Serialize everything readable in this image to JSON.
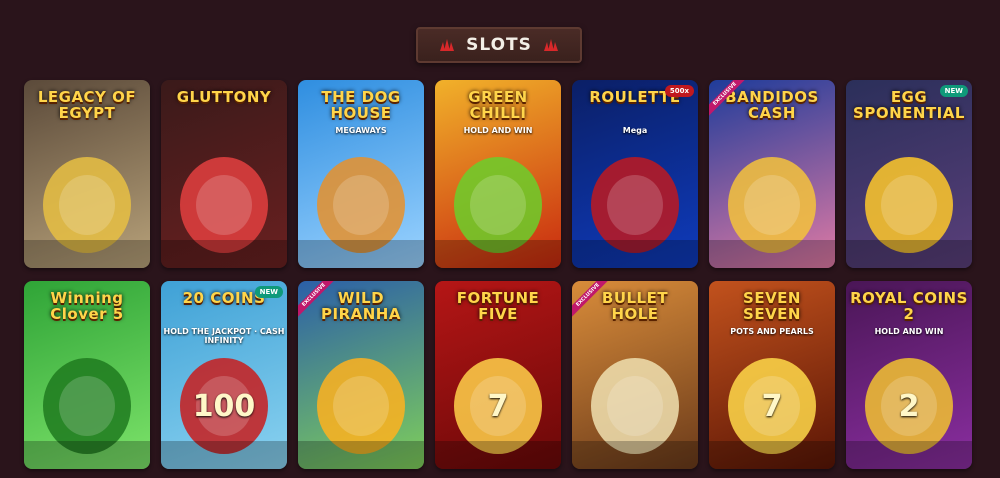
{
  "section": {
    "title": "SLOTS"
  },
  "games": [
    {
      "name": "LEGACY OF EGYPT",
      "sub": "",
      "bg": [
        "#5b4a3a",
        "#b8a27a"
      ],
      "accent": "#e8c043"
    },
    {
      "name": "GLUTTONY",
      "sub": "",
      "bg": [
        "#3a1a1a",
        "#6a2020"
      ],
      "accent": "#e34040"
    },
    {
      "name": "THE DOG HOUSE",
      "sub": "MEGAWAYS",
      "bg": [
        "#2f8ee0",
        "#9bd3ff"
      ],
      "accent": "#e8902a"
    },
    {
      "name": "GREEN CHILLI",
      "sub": "HOLD AND WIN",
      "bg": [
        "#f1b12a",
        "#c8290f"
      ],
      "accent": "#6bcf2b"
    },
    {
      "name": "ROULETTE",
      "sub": "Mega",
      "badge_value": "500x",
      "bg": [
        "#0b1f66",
        "#0e3bbd"
      ],
      "accent": "#c0191f"
    },
    {
      "name": "BANDIDOS CASH",
      "sub": "",
      "ribbon": "EXCLUSIVE",
      "bg": [
        "#1f3c9a",
        "#e07aa4"
      ],
      "accent": "#f5c33b"
    },
    {
      "name": "EGG SPONENTIAL",
      "sub": "",
      "new": "NEW",
      "bg": [
        "#2b2f5a",
        "#5a3f7a"
      ],
      "accent": "#ffc92a"
    },
    {
      "name": "Winning Clover 5",
      "sub": "",
      "bg": [
        "#2fa437",
        "#7de36a"
      ],
      "accent": "#1f7a1f"
    },
    {
      "name": "20 COINS",
      "sub": "HOLD THE JACKPOT · CASH INFINITY",
      "new": "NEW",
      "value": "100",
      "bg": [
        "#3fa1d6",
        "#8ad2f0"
      ],
      "accent": "#c91c1c"
    },
    {
      "name": "WILD PIRANHA",
      "sub": "",
      "ribbon": "EXCLUSIVE",
      "bg": [
        "#2b5fa8",
        "#7fcf5a"
      ],
      "accent": "#ffb21f"
    },
    {
      "name": "FORTUNE FIVE",
      "sub": "",
      "value": "7",
      "bg": [
        "#b51616",
        "#6a0808"
      ],
      "accent": "#ffd14a"
    },
    {
      "name": "BULLET HOLE",
      "sub": "",
      "ribbon": "EXCLUSIVE",
      "bg": [
        "#d98c3a",
        "#6a3a1a"
      ],
      "accent": "#f0e0b0"
    },
    {
      "name": "SEVEN SEVEN",
      "sub": "POTS AND PEARLS",
      "value": "7",
      "bg": [
        "#c2521d",
        "#5a1505"
      ],
      "accent": "#ffd94a"
    },
    {
      "name": "ROYAL COINS 2",
      "sub": "HOLD AND WIN",
      "value": "2",
      "bg": [
        "#4a1656",
        "#8a2ea0"
      ],
      "accent": "#f2c230"
    }
  ]
}
